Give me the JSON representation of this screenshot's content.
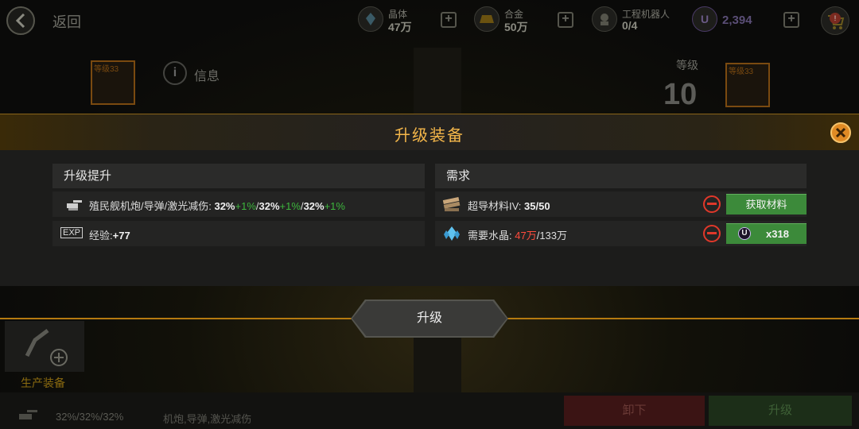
{
  "topbar": {
    "back_label": "返回",
    "resources": [
      {
        "name": "晶体",
        "value": "47万",
        "icon": "crystal-icon"
      },
      {
        "name": "合金",
        "value": "50万",
        "icon": "alloy-icon"
      },
      {
        "name": "工程机器人",
        "value": "0/4",
        "icon": "robot-icon"
      },
      {
        "name": "",
        "value": "2,394",
        "icon": "u-coin-icon"
      }
    ],
    "shop_badge": "!"
  },
  "header": {
    "left_thumb_level": "等级33",
    "info_label": "信息",
    "level_label": "等级",
    "level_value": "10",
    "right_thumb_level": "等级33"
  },
  "dialog": {
    "title": "升级装备",
    "upgrade_section": {
      "heading": "升级提升",
      "stat_row": {
        "label": "殖民舰机炮/导弹/激光减伤:",
        "v1": "32%",
        "b1": "+1%",
        "v2": "32%",
        "b2": "+1%",
        "v3": "32%",
        "b3": "+1%"
      },
      "exp_row": {
        "icon_text": "EXP",
        "label": "经验:",
        "value": "+77"
      }
    },
    "requirements_section": {
      "heading": "需求",
      "material_row": {
        "label": "超导材料IV:",
        "have": "35",
        "need": "/50",
        "button": "获取材料"
      },
      "crystal_row": {
        "label": "需要水晶:",
        "have": "47万",
        "need": "/133万",
        "coin_letter": "U",
        "button_value": "x318"
      }
    }
  },
  "upgrade_button": "升级",
  "bottom": {
    "produce_label": "生产装备",
    "stat_text": "32%/32%/32%",
    "stat_desc": "机炮,导弹,激光减伤",
    "unequip_label": "卸下",
    "upgrade_label": "升级"
  },
  "colors": {
    "accent_gold": "#f3b64a",
    "bonus_green": "#3db63d",
    "deficit_red": "#ff4b3c",
    "button_green": "#3c8a3a"
  }
}
